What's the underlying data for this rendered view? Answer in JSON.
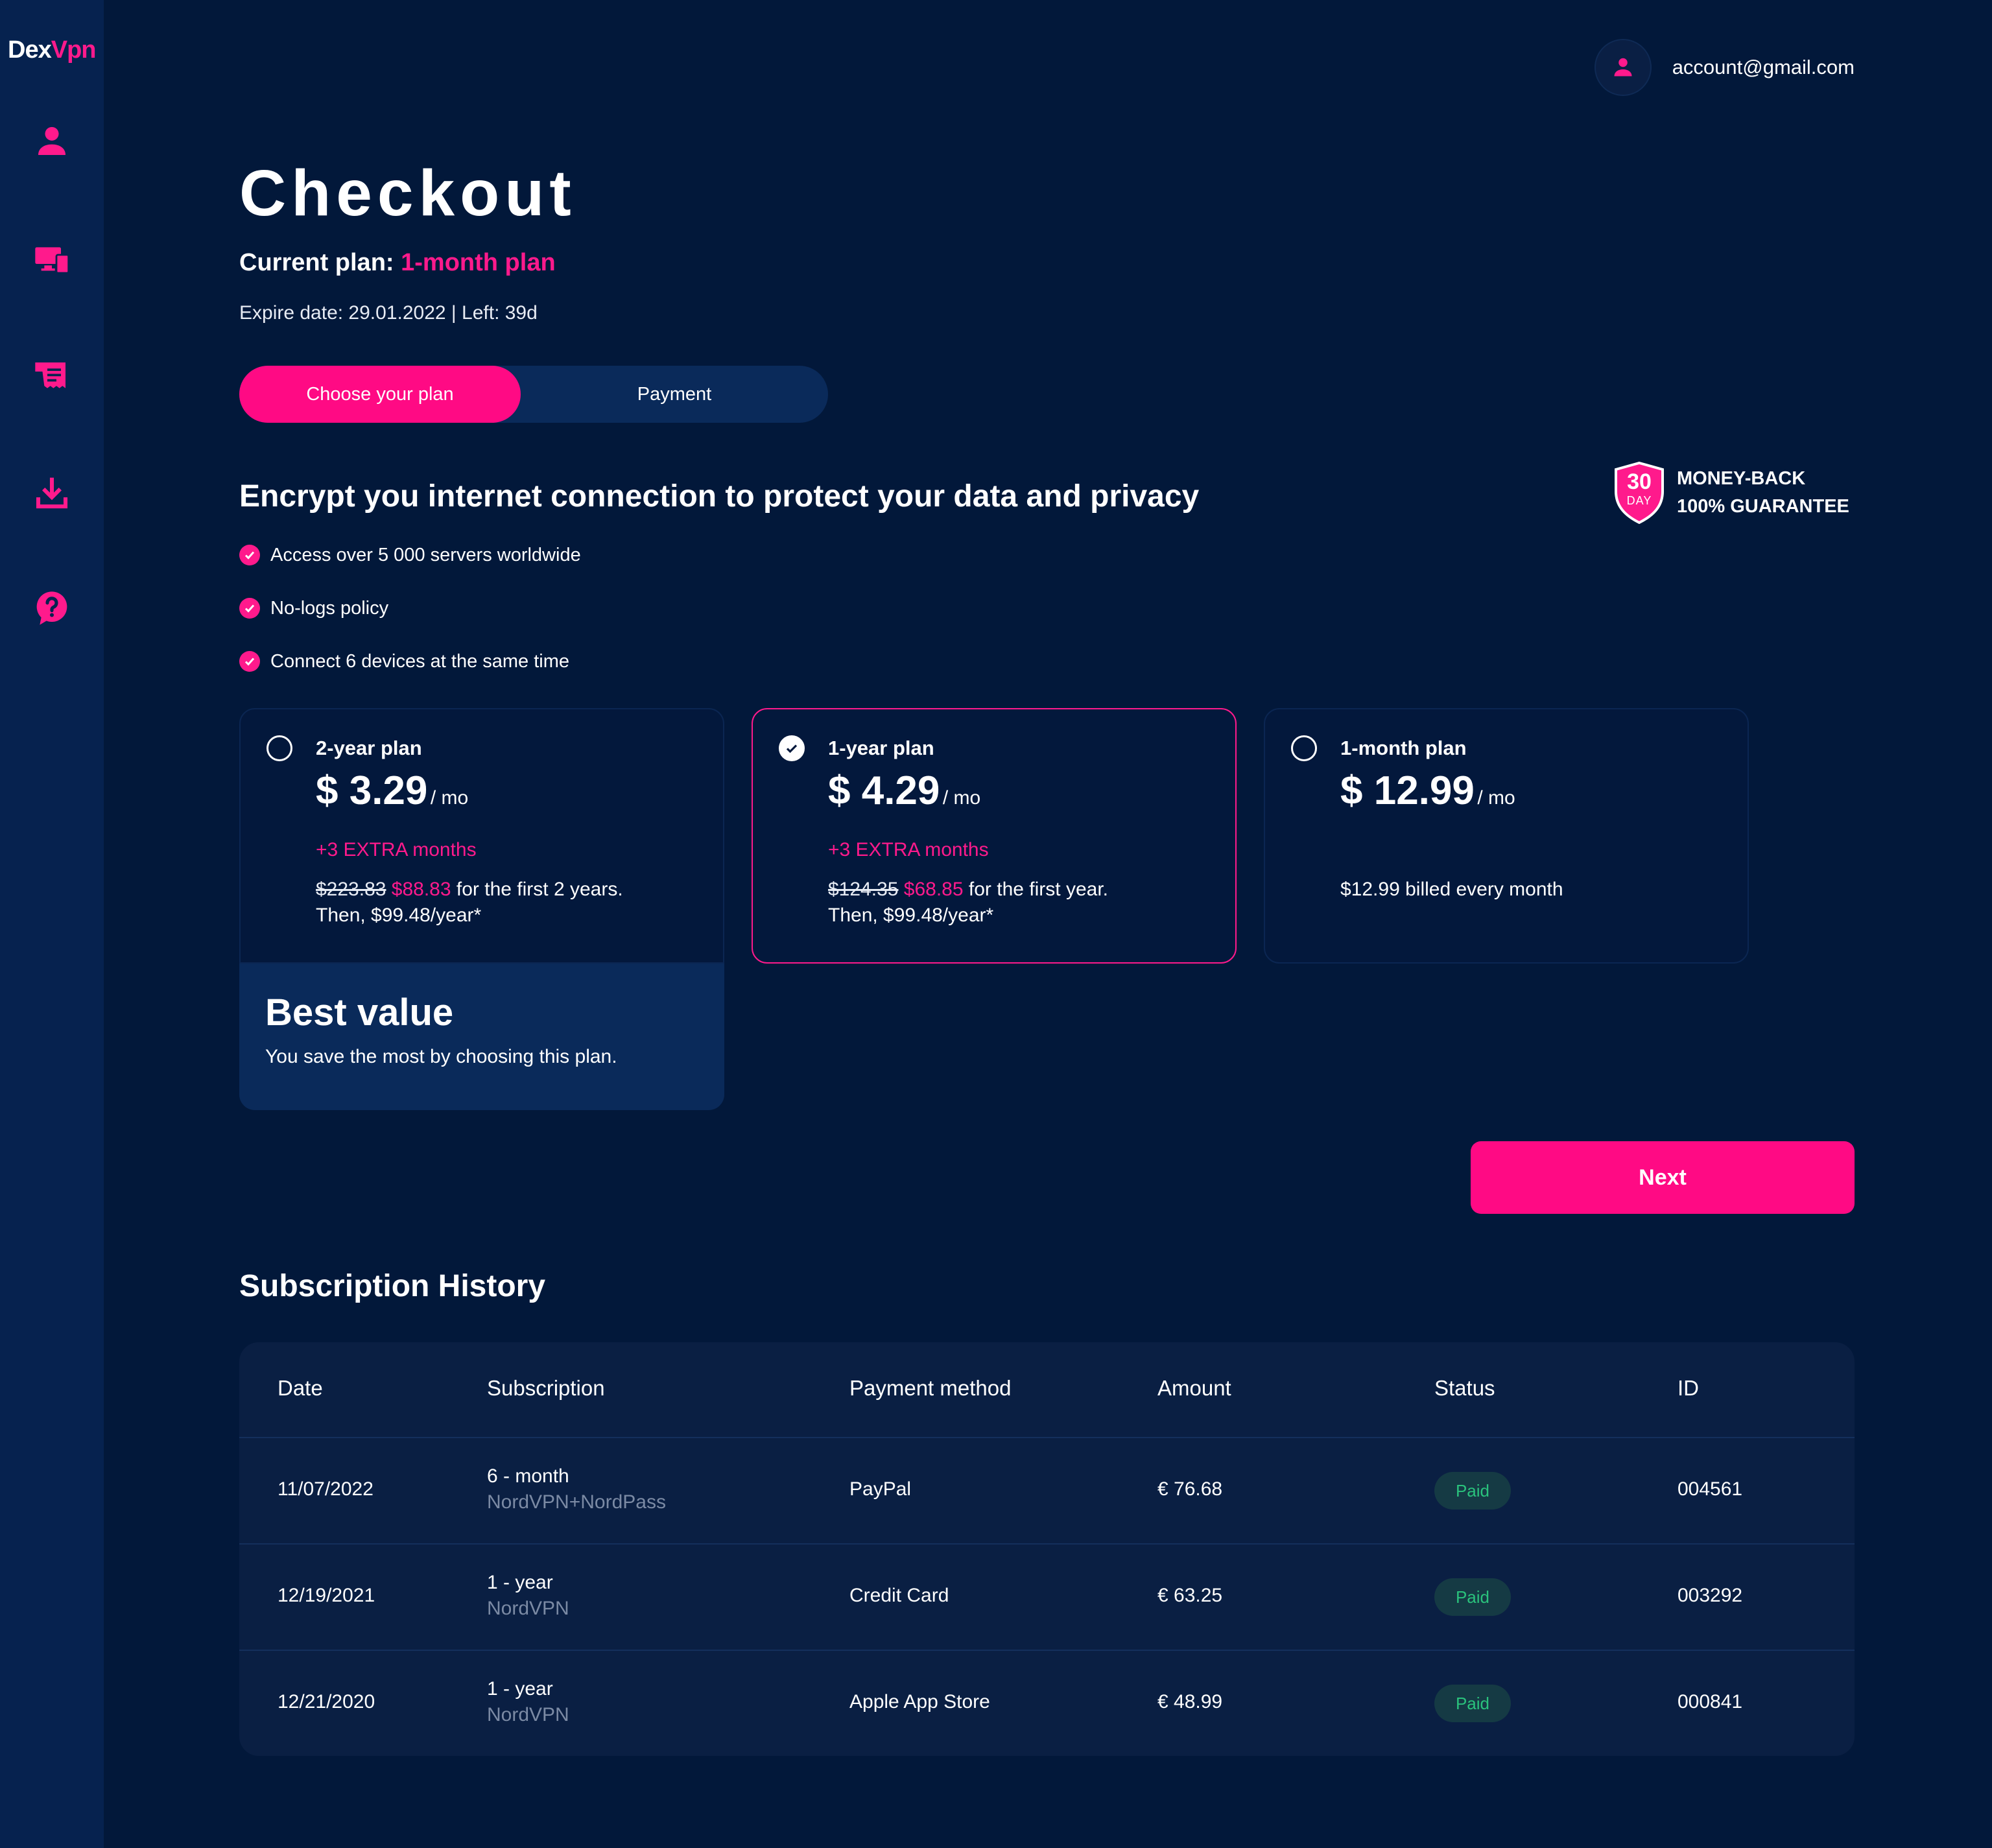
{
  "brand": {
    "part1": "Dex",
    "part2": "Vpn"
  },
  "account": {
    "email": "account@gmail.com",
    "icon": "user-icon"
  },
  "sidebar": {
    "items": [
      {
        "name": "profile",
        "icon": "user-icon"
      },
      {
        "name": "devices",
        "icon": "devices-icon"
      },
      {
        "name": "billing",
        "icon": "receipt-icon"
      },
      {
        "name": "download",
        "icon": "download-icon"
      },
      {
        "name": "help",
        "icon": "help-icon"
      }
    ]
  },
  "page": {
    "title": "Checkout",
    "current_plan_label": "Current plan:",
    "current_plan_value": "1-month plan",
    "expire": "Expire date: 29.01.2022 | Left: 39d"
  },
  "tabs": [
    {
      "label": "Choose your plan",
      "active": true
    },
    {
      "label": "Payment",
      "active": false
    }
  ],
  "headline": "Encrypt you internet connection to protect your data and privacy",
  "guarantee": {
    "days": "30",
    "day_label": "DAY",
    "line1": "MONEY-BACK",
    "line2": "100% GUARANTEE"
  },
  "features": [
    "Access over 5 000 servers worldwide",
    "No-logs policy",
    "Connect 6 devices at the same time"
  ],
  "plans": [
    {
      "name": "2-year plan",
      "price": "$ 3.29",
      "per": "/ mo",
      "extra": "+3 EXTRA months",
      "old": "$223.83",
      "new": "$88.83",
      "desc": "for the first 2 years.",
      "then": "Then, $99.48/year*",
      "selected": false
    },
    {
      "name": "1-year plan",
      "price": "$ 4.29",
      "per": "/ mo",
      "extra": "+3 EXTRA months",
      "old": "$124.35",
      "new": "$68.85",
      "desc": "for the first year.",
      "then": "Then, $99.48/year*",
      "selected": true
    },
    {
      "name": "1-month plan",
      "price": "$ 12.99",
      "per": "/ mo",
      "billing": "$12.99 billed every month",
      "selected": false
    }
  ],
  "best_value": {
    "title": "Best value",
    "subtitle": "You save the most by choosing this plan."
  },
  "next_label": "Next",
  "history": {
    "title": "Subscription History",
    "columns": [
      "Date",
      "Subscription",
      "Payment method",
      "Amount",
      "Status",
      "ID"
    ],
    "rows": [
      {
        "date": "11/07/2022",
        "sub_main": "6 - month",
        "sub_second": "NordVPN+NordPass",
        "method": "PayPal",
        "amount": "€ 76.68",
        "status": "Paid",
        "id": "004561"
      },
      {
        "date": "12/19/2021",
        "sub_main": "1 - year",
        "sub_second": "NordVPN",
        "method": "Credit Card",
        "amount": "€ 63.25",
        "status": "Paid",
        "id": "003292"
      },
      {
        "date": "12/21/2020",
        "sub_main": "1 - year",
        "sub_second": "NordVPN",
        "method": "Apple App Store",
        "amount": "€ 48.99",
        "status": "Paid",
        "id": "000841"
      }
    ]
  },
  "colors": {
    "accent": "#ff1a8c",
    "background": "#02183a",
    "sidebar": "#06224f",
    "paid": "#2ac27c"
  }
}
